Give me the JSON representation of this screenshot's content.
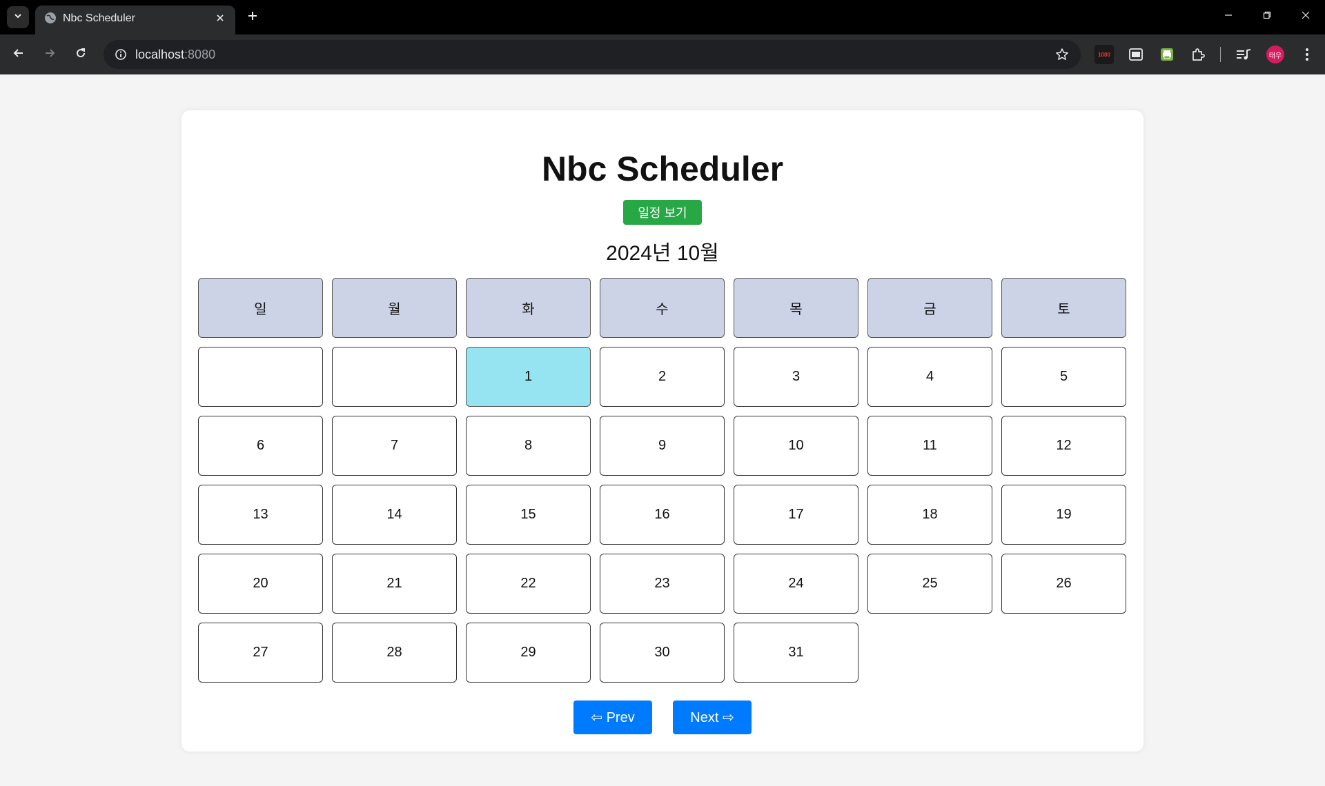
{
  "browser": {
    "tab_title": "Nbc Scheduler",
    "url_host": "localhost",
    "url_port": ":8080",
    "extension_1080_label": "1080",
    "profile_initials": "태우"
  },
  "page": {
    "title": "Nbc Scheduler",
    "view_schedule_button": "일정 보기",
    "month_label": "2024년 10월",
    "weekdays": [
      "일",
      "월",
      "화",
      "수",
      "목",
      "금",
      "토"
    ],
    "weeks": [
      [
        "",
        "",
        "1",
        "2",
        "3",
        "4",
        "5"
      ],
      [
        "6",
        "7",
        "8",
        "9",
        "10",
        "11",
        "12"
      ],
      [
        "13",
        "14",
        "15",
        "16",
        "17",
        "18",
        "19"
      ],
      [
        "20",
        "21",
        "22",
        "23",
        "24",
        "25",
        "26"
      ],
      [
        "27",
        "28",
        "29",
        "30",
        "31",
        null,
        null
      ]
    ],
    "highlighted_day": "1",
    "prev_button": "⇦ Prev",
    "next_button": "Next ⇨"
  },
  "colors": {
    "view_button": "#28a745",
    "nav_buttons": "#007bff",
    "weekday_header": "#ccd3e6",
    "today_highlight": "#96e3f2"
  }
}
